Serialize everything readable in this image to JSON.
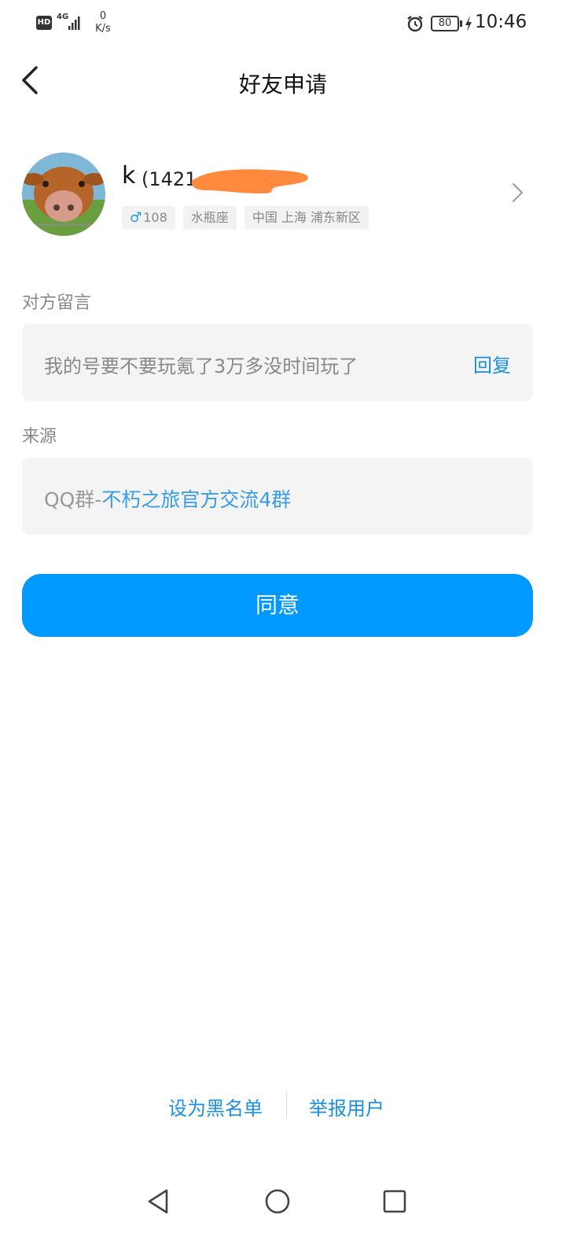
{
  "status_bar": {
    "hd": "HD",
    "network": "4G",
    "speed_value": "0",
    "speed_unit": "K/s",
    "battery": "80",
    "time": "10:46"
  },
  "header": {
    "title": "好友申请"
  },
  "profile": {
    "nickname": "k",
    "qq_number_visible": "(1421",
    "tags": {
      "age": "108",
      "zodiac": "水瓶座",
      "location": "中国 上海 浦东新区"
    }
  },
  "message_section": {
    "label": "对方留言",
    "text": "我的号要不要玩氪了3万多没时间玩了",
    "reply_label": "回复"
  },
  "source_section": {
    "label": "来源",
    "prefix": "QQ群-",
    "group_name": "不朽之旅官方交流4群"
  },
  "actions": {
    "agree_label": "同意",
    "blacklist_label": "设为黑名单",
    "report_label": "举报用户"
  },
  "colors": {
    "accent": "#0099ff",
    "link": "#1a8fe0",
    "card_bg": "#f4f4f4",
    "redaction": "#ff8a3d"
  }
}
